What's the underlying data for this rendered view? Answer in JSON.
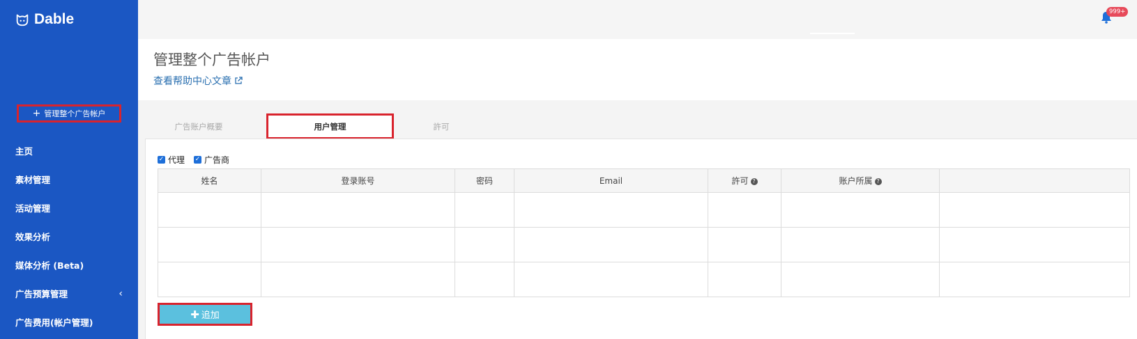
{
  "app": {
    "logo_text": "Dable"
  },
  "sidebar": {
    "manage_button_label": "管理整个广告帐户",
    "items": [
      {
        "label": "主页"
      },
      {
        "label": "素材管理"
      },
      {
        "label": "活动管理"
      },
      {
        "label": "效果分析"
      },
      {
        "label": "媒体分析 (Beta)"
      },
      {
        "label": "广告预算管理"
      },
      {
        "label": "广告费用(帐户管理)"
      }
    ]
  },
  "topbar": {
    "notification_badge": "999+"
  },
  "header": {
    "title": "管理整个广告帐户",
    "help_link": "查看帮助中心文章"
  },
  "tabs": [
    {
      "label": "广告账户概要"
    },
    {
      "label": "用户管理"
    },
    {
      "label": "許可"
    }
  ],
  "filters": {
    "agency_label": "代理",
    "agency_checked": true,
    "advertiser_label": "广告商",
    "advertiser_checked": true
  },
  "table": {
    "columns": [
      "姓名",
      "登录账号",
      "密码",
      "Email",
      "許可",
      "账户所属",
      ""
    ],
    "rows": [
      [],
      [],
      []
    ]
  },
  "add_button_label": "追加",
  "colors": {
    "sidebar": "#1b57c3",
    "highlight_border": "#d9232d",
    "add_button": "#5bc0de",
    "badge": "#e74a5a"
  }
}
